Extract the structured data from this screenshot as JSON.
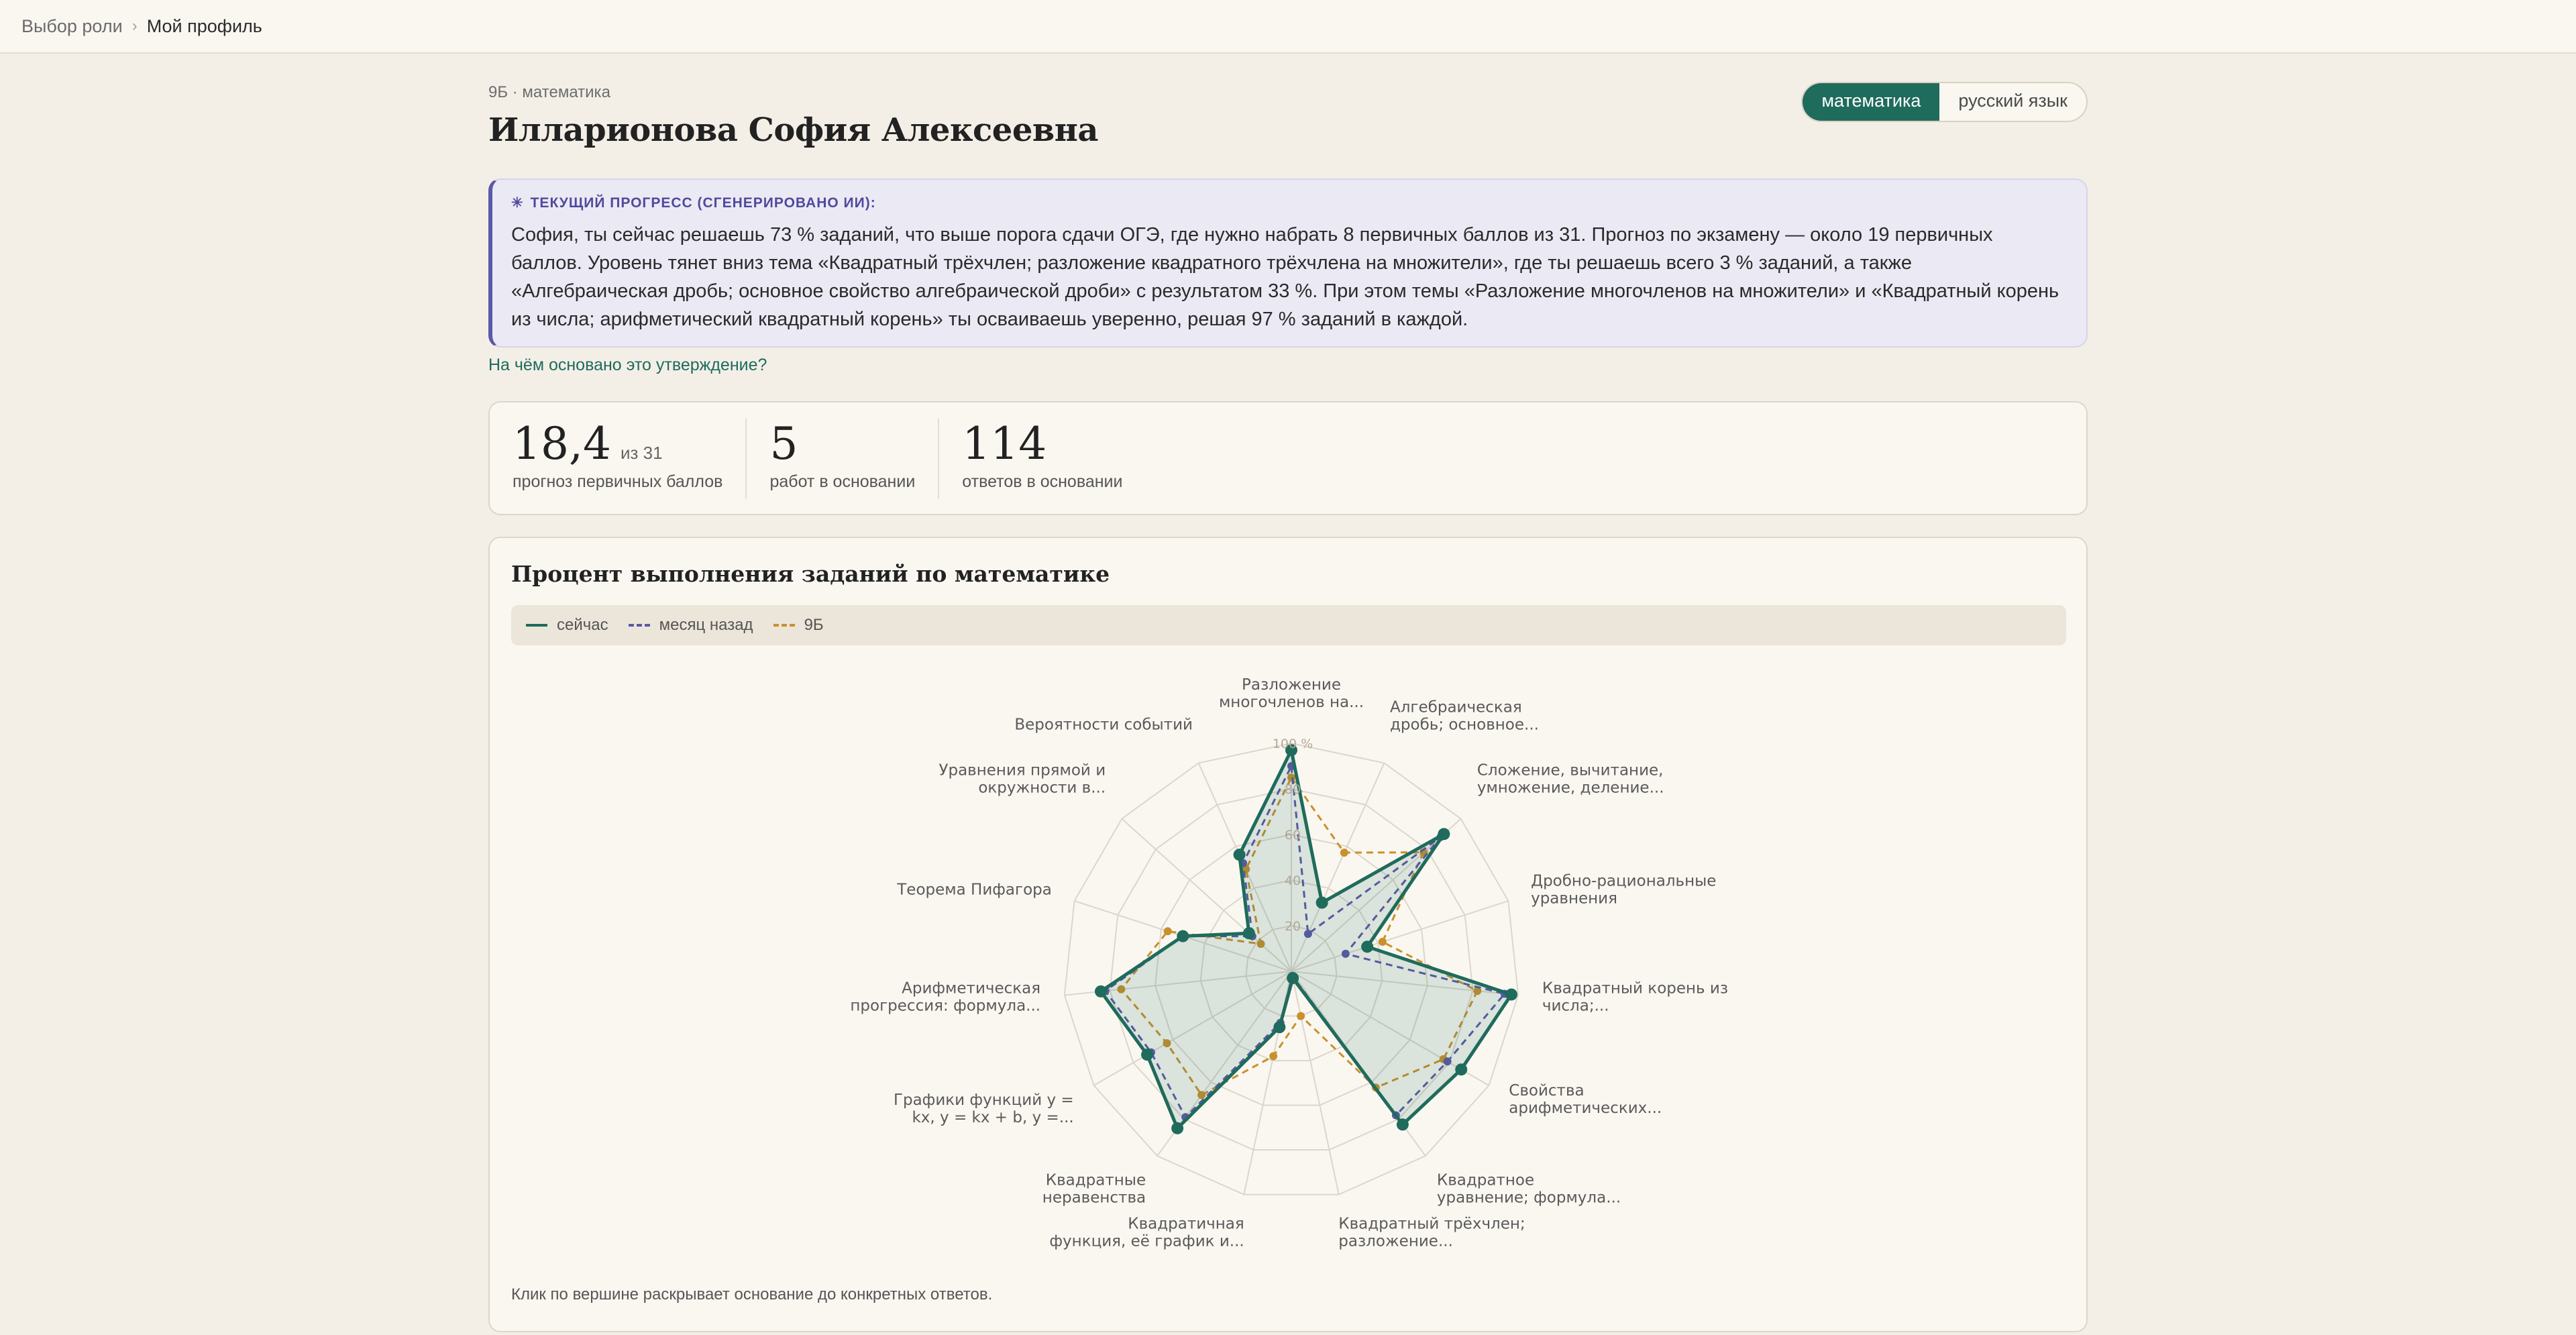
{
  "breadcrumb": {
    "root": "Выбор роли",
    "separator": "›",
    "current": "Мой профиль"
  },
  "profile": {
    "eyebrow": "9Б · математика",
    "name": "Илларионова София Алексеевна"
  },
  "subjects": {
    "options": [
      "математика",
      "русский язык"
    ],
    "selected": "математика"
  },
  "ai": {
    "icon": "sparkle-icon",
    "label": "ТЕКУЩИЙ ПРОГРЕСС (СГЕНЕРИРОВАНО ИИ):",
    "text": "София, ты сейчас решаешь 73 % заданий, что выше порога сдачи ОГЭ, где нужно набрать 8 первичных баллов из 31. Прогноз по экзамену — около 19 первичных баллов. Уровень тянет вниз тема «Квадратный трёхчлен; разложение квадратного трёхчлена на множители», где ты решаешь всего 3 % заданий, а также «Алгебраическая дробь; основное свойство алгебраической дроби» с результатом 33 %. При этом темы «Разложение многочленов на множители» и «Квадратный корень из числа; арифметический квадратный корень» ты осваиваешь уверенно, решая 97 % заданий в каждой.",
    "basis_link": "На чём основано это утверждение?"
  },
  "stats": [
    {
      "value": "18,4",
      "suffix": "из 31",
      "label": "прогноз первичных баллов"
    },
    {
      "value": "5",
      "suffix": "",
      "label": "работ в основании"
    },
    {
      "value": "114",
      "suffix": "",
      "label": "ответов в основании"
    }
  ],
  "chart": {
    "title": "Процент выполнения заданий по математике",
    "note": "Клик по вершине раскрывает основание до конкретных ответов.",
    "legend": [
      {
        "name": "сейчас",
        "color": "#1f6b5c",
        "dashed": false
      },
      {
        "name": "месяц назад",
        "color": "#5c58a8",
        "dashed": true
      },
      {
        "name": "9Б",
        "color": "#c8912a",
        "dashed": true
      }
    ]
  },
  "chart_data": {
    "type": "radar",
    "r_ticks": [
      "20",
      "40",
      "60",
      "80",
      "100 %"
    ],
    "rlim": [
      0,
      100
    ],
    "categories": [
      [
        "Разложение",
        "многочленов на..."
      ],
      [
        "Алгебраическая",
        "дробь; основное..."
      ],
      [
        "Сложение, вычитание,",
        "умножение, деление..."
      ],
      [
        "Дробно-рациональные",
        "уравнения"
      ],
      [
        "Квадратный корень из",
        "числа;..."
      ],
      [
        "Свойства",
        "арифметических..."
      ],
      [
        "Квадратное",
        "уравнение; формула..."
      ],
      [
        "Квадратный трёхчлен;",
        "разложение..."
      ],
      [
        "Квадратичная",
        "функция, её график и..."
      ],
      [
        "Квадратные",
        "неравенства"
      ],
      [
        "Графики функций y =",
        "kx, y = kx + b, y =..."
      ],
      [
        "Арифметическая",
        "прогрессия: формула..."
      ],
      [
        "Теорема Пифагора"
      ],
      [
        "Уравнения прямой и",
        "окружности в..."
      ],
      [
        "Вероятности событий"
      ]
    ],
    "series": [
      {
        "name": "сейчас",
        "color": "#1f6b5c",
        "values": [
          97,
          33,
          90,
          35,
          97,
          86,
          83,
          3,
          25,
          85,
          73,
          84,
          50,
          25,
          56
        ]
      },
      {
        "name": "месяц назад",
        "color": "#5c58a8",
        "values": [
          90,
          18,
          88,
          25,
          94,
          79,
          78,
          2,
          23,
          79,
          71,
          82,
          50,
          23,
          52
        ]
      },
      {
        "name": "9Б",
        "color": "#c8912a",
        "values": [
          85,
          57,
          78,
          42,
          82,
          77,
          63,
          20,
          38,
          67,
          63,
          75,
          57,
          18,
          49
        ]
      }
    ]
  }
}
